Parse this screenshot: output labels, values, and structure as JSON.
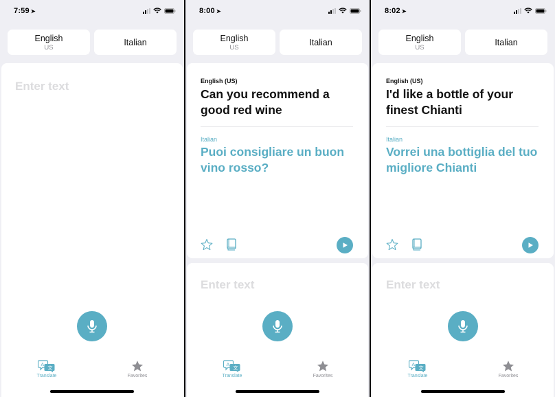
{
  "accent_color": "#5aaec4",
  "screens": [
    {
      "status": {
        "time": "7:59"
      },
      "languages": {
        "source": {
          "name": "English",
          "region": "US"
        },
        "target": {
          "name": "Italian"
        }
      },
      "input": {
        "placeholder": "Enter text"
      },
      "tabs": {
        "translate": "Translate",
        "favorites": "Favorites"
      }
    },
    {
      "status": {
        "time": "8:00"
      },
      "languages": {
        "source": {
          "name": "English",
          "region": "US"
        },
        "target": {
          "name": "Italian"
        }
      },
      "result": {
        "source_label": "English (US)",
        "source_text": "Can you recommend a good red wine",
        "target_label": "Italian",
        "target_text": "Puoi consigliare un buon vino rosso?"
      },
      "input": {
        "placeholder": "Enter text"
      },
      "tabs": {
        "translate": "Translate",
        "favorites": "Favorites"
      }
    },
    {
      "status": {
        "time": "8:02"
      },
      "languages": {
        "source": {
          "name": "English",
          "region": "US"
        },
        "target": {
          "name": "Italian"
        }
      },
      "result": {
        "source_label": "English (US)",
        "source_text": "I'd like a bottle of your finest Chianti",
        "target_label": "Italian",
        "target_text": "Vorrei una bottiglia del tuo migliore Chianti"
      },
      "input": {
        "placeholder": "Enter text"
      },
      "tabs": {
        "translate": "Translate",
        "favorites": "Favorites"
      }
    }
  ]
}
